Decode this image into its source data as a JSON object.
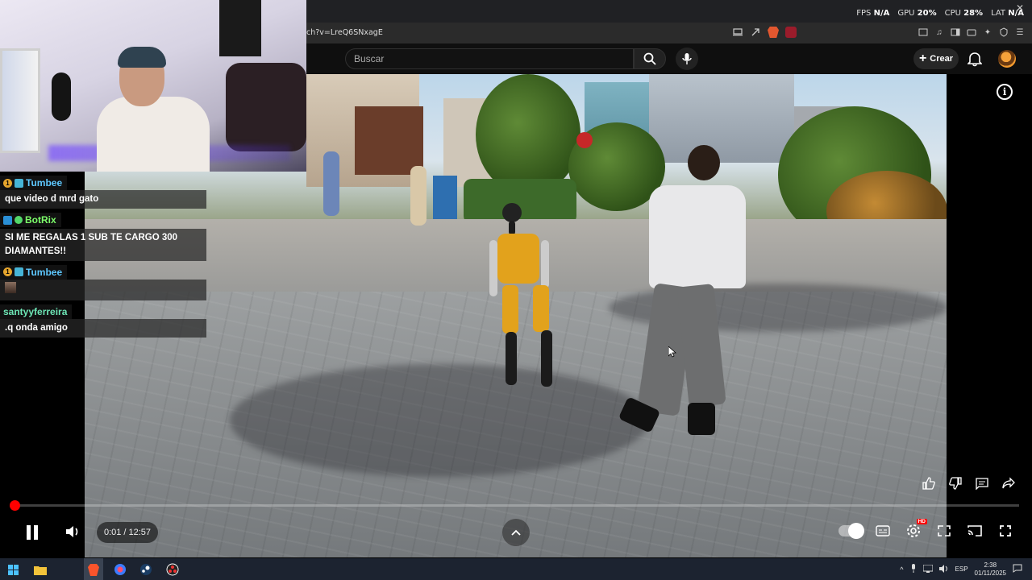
{
  "browser": {
    "url": "ch?v=LreQ6SNxagE",
    "close_glyph": "✕"
  },
  "overlay_stats": {
    "fps_label": "FPS",
    "fps_value": "N/A",
    "gpu_label": "GPU",
    "gpu_value": "20%",
    "cpu_label": "CPU",
    "cpu_value": "28%",
    "lat_label": "LAT",
    "lat_value": "N/A"
  },
  "youtube": {
    "search_placeholder": "Buscar",
    "create_label": "Crear",
    "player": {
      "current_time": "0:01",
      "separator": " / ",
      "duration": "12:57",
      "time_display": "0:01 / 12:57",
      "progress_fraction": 0.0013,
      "quality_badge": "HD"
    }
  },
  "chat": {
    "messages": [
      {
        "user": "Tumbee",
        "user_color": "#5ec8ff",
        "badges": [
          "sub-1",
          "sq"
        ],
        "text": "que video d mrd gato"
      },
      {
        "user": "BotRix",
        "user_color": "#7dff6a",
        "badges": [
          "mod",
          "verified"
        ],
        "text": "SI ME REGALAS 1 SUB TE CARGO 300 DIAMANTES!!"
      },
      {
        "user": "Tumbee",
        "user_color": "#5ec8ff",
        "badges": [
          "sub-1",
          "sq"
        ],
        "text": "",
        "emote": "emote"
      },
      {
        "user": "santyyferreira",
        "user_color": "#6ee7b7",
        "badges": [],
        "text": ".q onda amigo"
      }
    ]
  },
  "taskbar": {
    "language": "ESP",
    "time": "2:38",
    "date": "01/11/2025"
  },
  "colors": {
    "progress": "#ff0000",
    "youtube_bg": "#0f0f0f",
    "taskbar_bg": "#1c2330"
  }
}
